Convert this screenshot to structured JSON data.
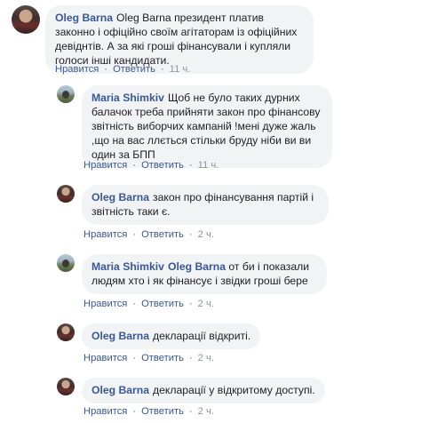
{
  "actions": {
    "like": "Нравится",
    "reply": "Ответить",
    "dot": "·"
  },
  "comments": [
    {
      "author": "Oleg Barna",
      "mention": "",
      "text": "Oleg Barna президент платив законно і офіційно своїм агітаторам із офіційних девіднтів. А за які гроші фінансували і купляли голоси інші кандидати.",
      "time": "11 ч."
    },
    {
      "author": "Maria Shimkiv",
      "mention": "",
      "text": "Щоб не було таких дурних балачок треба прийняти закон про фінансову звітність виборчих кампаній !мені дуже жаль ,що на вас ллється стільки бруду ніби ви ви один за БПП",
      "time": "11 ч."
    },
    {
      "author": "Oleg Barna",
      "mention": "",
      "text": "закон про фінансування партій і звітність таки є.",
      "time": "2 ч."
    },
    {
      "author": "Maria Shimkiv",
      "mention": "Oleg Barna",
      "text": "от би і показали людям хто і як фінансує і звідки гроші бере",
      "time": "2 ч."
    },
    {
      "author": "Oleg Barna",
      "mention": "",
      "text": "декларації відкриті.",
      "time": "2 ч."
    },
    {
      "author": "Oleg Barna",
      "mention": "",
      "text": "декларації у відкритому доступі.",
      "time": "2 ч."
    }
  ]
}
